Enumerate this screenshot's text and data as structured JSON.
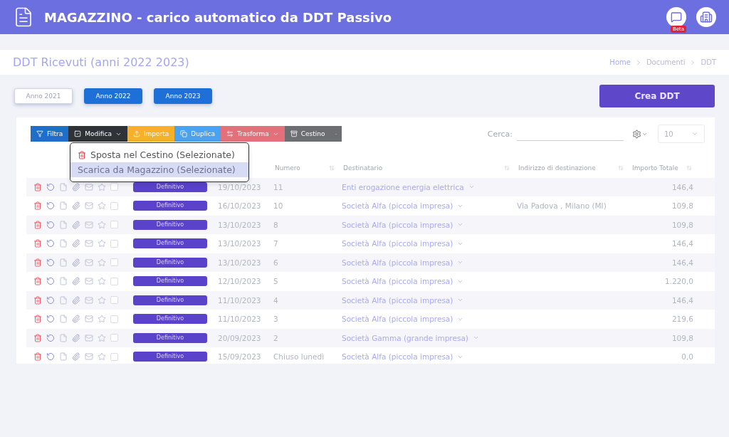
{
  "header": {
    "title": "MAGAZZINO - carico automatico da DDT Passivo",
    "beta_badge": "Beta"
  },
  "page_title": "DDT Ricevuti (anni 2022 2023)",
  "breadcrumb": [
    "Home",
    "Documenti",
    "DDT"
  ],
  "year_filters": [
    {
      "label": "Anno 2021",
      "selected": false
    },
    {
      "label": "Anno 2022",
      "selected": true
    },
    {
      "label": "Anno 2023",
      "selected": true
    }
  ],
  "create_button": "Crea DDT",
  "toolbar": [
    {
      "label": "Filtra",
      "color": "#1f6fc9",
      "caret": false
    },
    {
      "label": "Modifica",
      "color": "#2f3237",
      "caret": true
    },
    {
      "label": "Importa",
      "color": "#f7b02a",
      "caret": false
    },
    {
      "label": "Duplica",
      "color": "#4aa3f0",
      "caret": false
    },
    {
      "label": "Trasforma",
      "color": "#e4707b",
      "caret": true
    },
    {
      "label": "Cestino",
      "color": "#6c6e71",
      "caret": false
    }
  ],
  "dropdown": {
    "items": [
      {
        "label": "Sposta nel Cestino (Selezionate)",
        "selected": false,
        "kind": "trash"
      },
      {
        "label": "Scarica da Magazzino (Selezionate)",
        "selected": true,
        "kind": "plain"
      }
    ]
  },
  "search": {
    "label": "Cerca:"
  },
  "page_size": "10",
  "columns": [
    "Numero",
    "Destinatario",
    "Indirizzo di destinazione",
    "Importo Totale"
  ],
  "rows": [
    {
      "status": "Definitivo",
      "date": "19/10/2023",
      "number": "11",
      "recipient": "Enti erogazione energia elettrica",
      "address": "",
      "amount": "146,4",
      "checked": false
    },
    {
      "status": "Definitivo",
      "date": "16/10/2023",
      "number": "10",
      "recipient": "Società Alfa (piccola impresa)",
      "address": "Via Padova , Milano (MI)",
      "amount": "109,8",
      "checked": false
    },
    {
      "status": "Definitivo",
      "date": "13/10/2023",
      "number": "8",
      "recipient": "Società Alfa (piccola impresa)",
      "address": "",
      "amount": "109,8",
      "checked": false
    },
    {
      "status": "Definitivo",
      "date": "13/10/2023",
      "number": "7",
      "recipient": "Società Alfa (piccola impresa)",
      "address": "",
      "amount": "146,4",
      "checked": false
    },
    {
      "status": "Definitivo",
      "date": "13/10/2023",
      "number": "6",
      "recipient": "Società Alfa (piccola impresa)",
      "address": "",
      "amount": "146,4",
      "checked": false
    },
    {
      "status": "Definitivo",
      "date": "12/10/2023",
      "number": "5",
      "recipient": "Società Alfa (piccola impresa)",
      "address": "",
      "amount": "1.220,0",
      "checked": false
    },
    {
      "status": "Definitivo",
      "date": "11/10/2023",
      "number": "4",
      "recipient": "Società Alfa (piccola impresa)",
      "address": "",
      "amount": "146,4",
      "checked": false
    },
    {
      "status": "Definitivo",
      "date": "11/10/2023",
      "number": "3",
      "recipient": "Società Alfa (piccola impresa)",
      "address": "",
      "amount": "219,6",
      "checked": false
    },
    {
      "status": "Definitivo",
      "date": "20/09/2023",
      "number": "2",
      "recipient": "Società Gamma (grande impresa)",
      "address": "",
      "amount": "109,8",
      "checked": false
    },
    {
      "status": "Definitivo",
      "date": "15/09/2023",
      "number": "Chiuso lunedì",
      "recipient": "Società Alfa (piccola impresa)",
      "address": "",
      "amount": "0,0",
      "checked": false
    }
  ]
}
